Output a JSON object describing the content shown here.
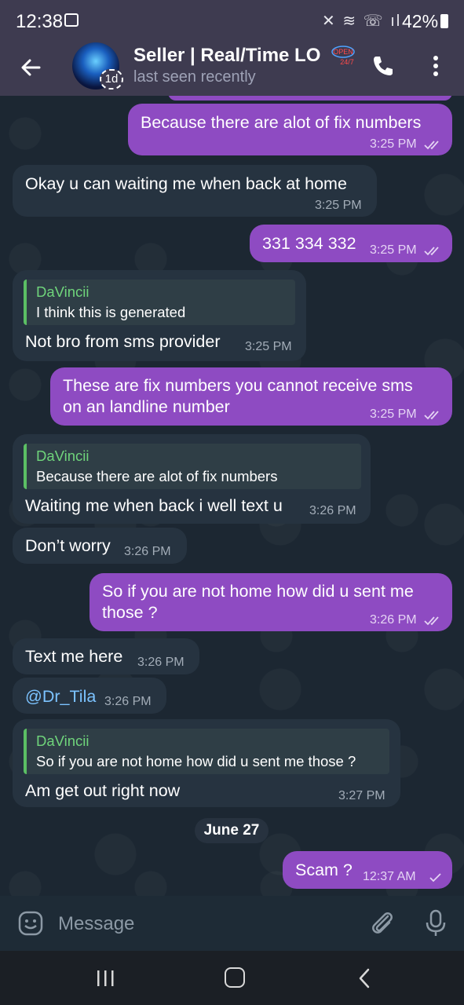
{
  "status_bar": {
    "time": "12:38",
    "battery": "42%"
  },
  "header": {
    "title": "Seller | Real/Time LO",
    "status": "last seen recently",
    "avatar_badge": "1d",
    "open_sign_top": "OPEN",
    "open_sign_bottom": "24/7"
  },
  "messages": [
    {
      "text": "Because there are alot of fix numbers",
      "time": "3:25 PM"
    },
    {
      "text": "Okay u can waiting me when back at home",
      "time": "3:25 PM"
    },
    {
      "text": "331 334 332",
      "time": "3:25 PM"
    },
    {
      "quote_name": "DaVincii",
      "quote_text": "I think this is generated",
      "text": "Not bro from sms provider",
      "time": "3:25 PM"
    },
    {
      "line1": "These are fix numbers you cannot receive sms",
      "line2": "on an landline number",
      "time": "3:25 PM"
    },
    {
      "quote_name": "DaVincii",
      "quote_text": "Because there are alot of fix numbers",
      "text": "Waiting me when back i well text u",
      "time": "3:26 PM"
    },
    {
      "text": "Don’t worry",
      "time": "3:26 PM"
    },
    {
      "line1": "So if you are not home how did u sent me",
      "line2": "those ?",
      "time": "3:26 PM"
    },
    {
      "text": "Text me here",
      "time": "3:26 PM"
    },
    {
      "text": "@Dr_Tila",
      "time": "3:26 PM"
    },
    {
      "quote_name": "DaVincii",
      "quote_text": "So if you are not home how did u sent me those ?",
      "text": "Am get out right now",
      "time": "3:27 PM"
    },
    {
      "text": "Scam ?",
      "time": "12:37 AM"
    }
  ],
  "date_separator": "June 27",
  "composer": {
    "placeholder": "Message"
  },
  "colors": {
    "header": "#3e3b50",
    "outgoing": "#8e4bc2",
    "incoming": "#263340",
    "quote_accent": "#5bbf64"
  }
}
